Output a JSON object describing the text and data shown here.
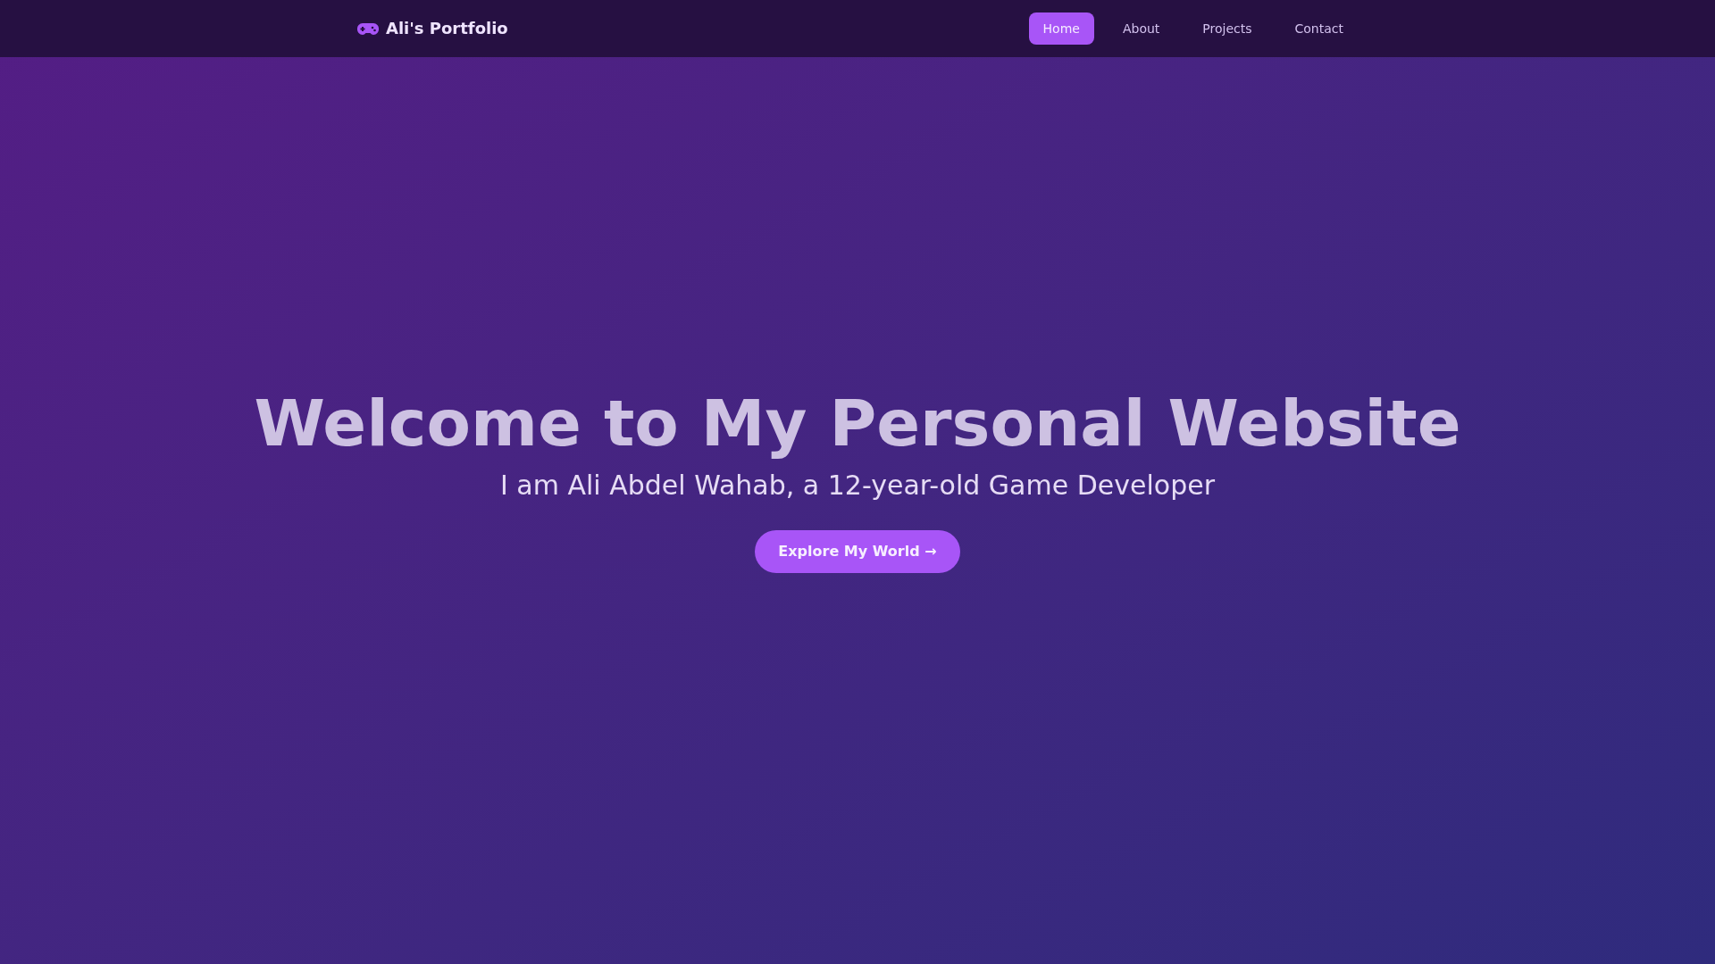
{
  "nav": {
    "logo": "Ali's Portfolio",
    "links": [
      {
        "label": "Home",
        "selected": true
      },
      {
        "label": "About",
        "selected": false
      },
      {
        "label": "Projects",
        "selected": false
      },
      {
        "label": "Contact",
        "selected": false
      }
    ]
  },
  "hero": {
    "title": "Welcome to My Personal Website",
    "subtitle": "I am Ali Abdel Wahab, a 12-year-old Game Developer",
    "button": "Explore My World →"
  }
}
